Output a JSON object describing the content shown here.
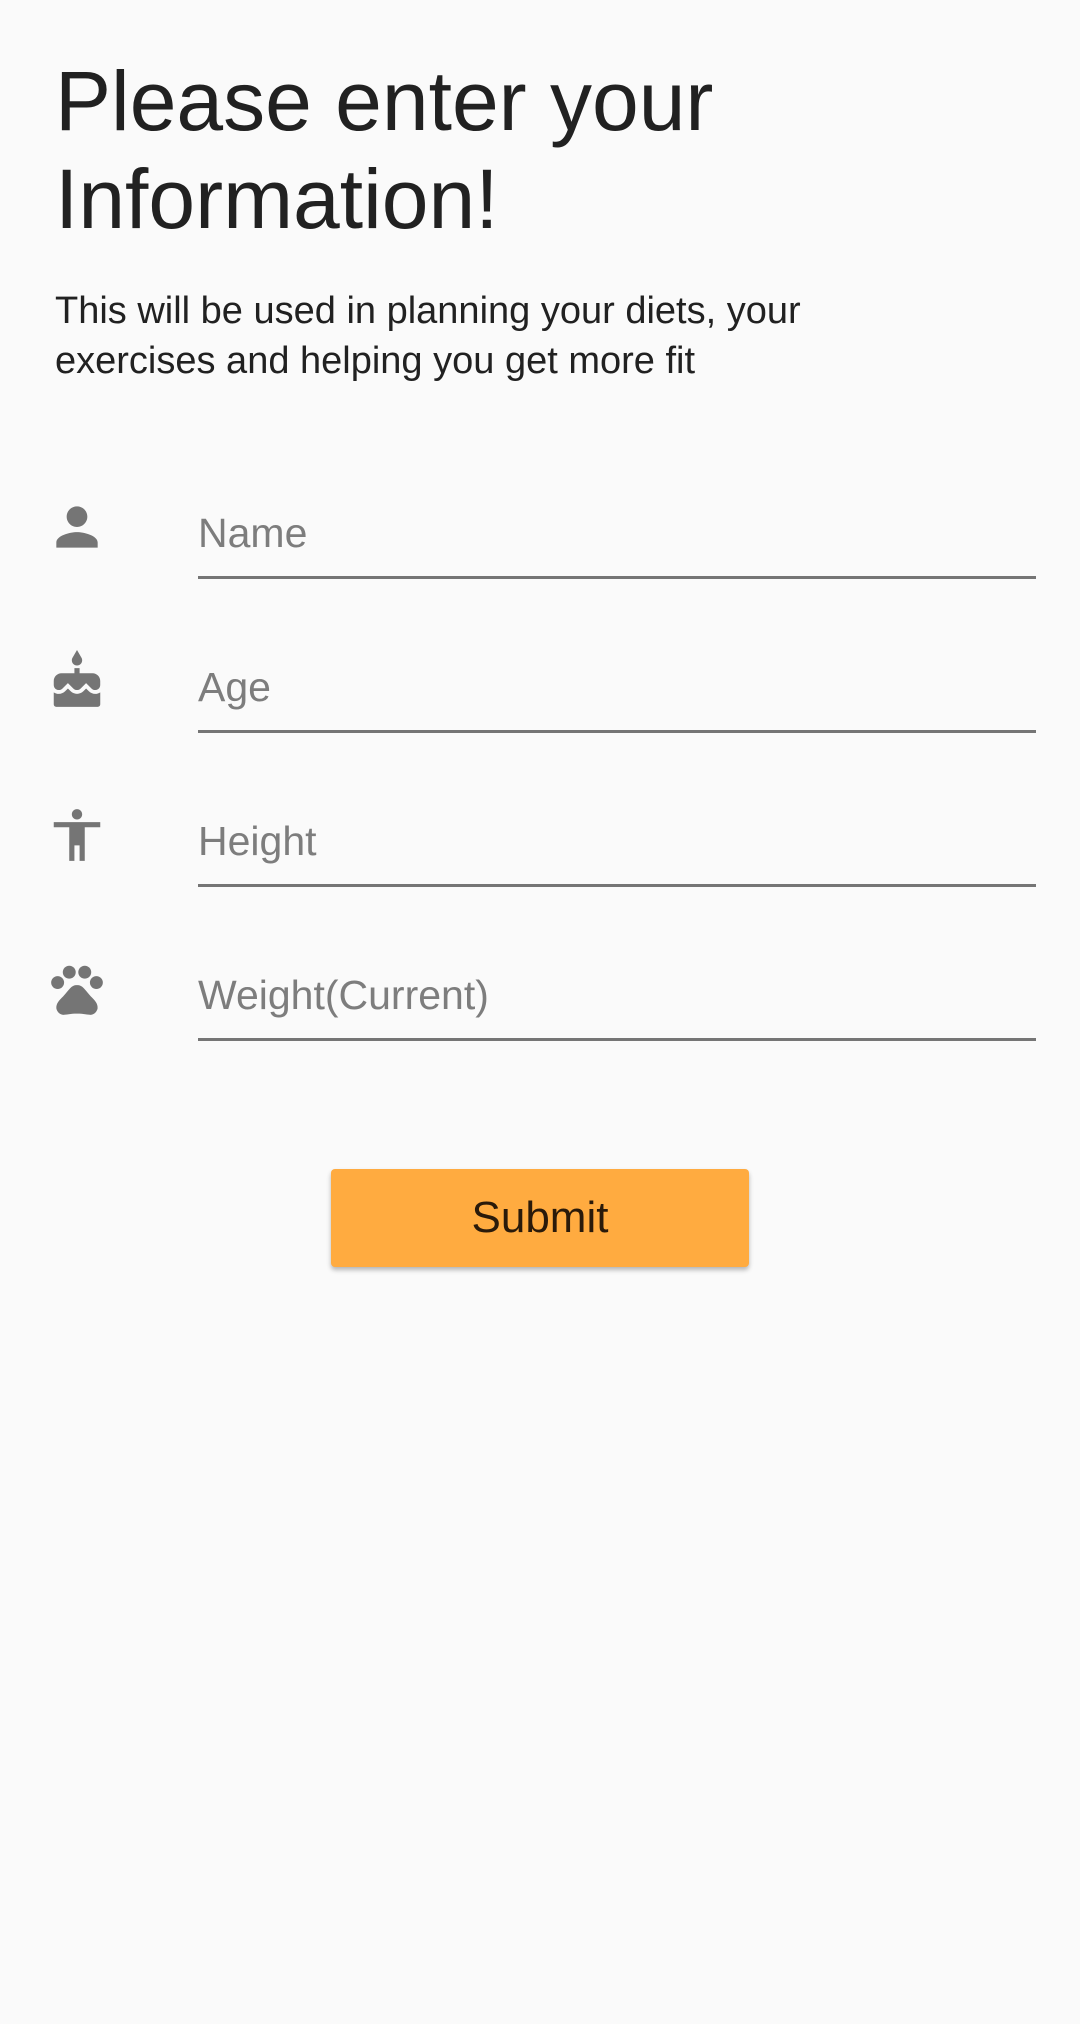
{
  "header": {
    "title": "Please enter your Information!",
    "subtitle": "This will be used in planning your diets, your exercises and helping you get more fit"
  },
  "form": {
    "fields": [
      {
        "icon": "person-icon",
        "placeholder": "Name",
        "value": ""
      },
      {
        "icon": "cake-icon",
        "placeholder": "Age",
        "value": ""
      },
      {
        "icon": "accessibility-icon",
        "placeholder": "Height",
        "value": ""
      },
      {
        "icon": "paw-icon",
        "placeholder": "Weight(Current)",
        "value": ""
      }
    ],
    "submit_label": "Submit"
  },
  "colors": {
    "background": "#fafafa",
    "accent": "#ffab40",
    "icon": "#757575",
    "text": "#212121"
  }
}
